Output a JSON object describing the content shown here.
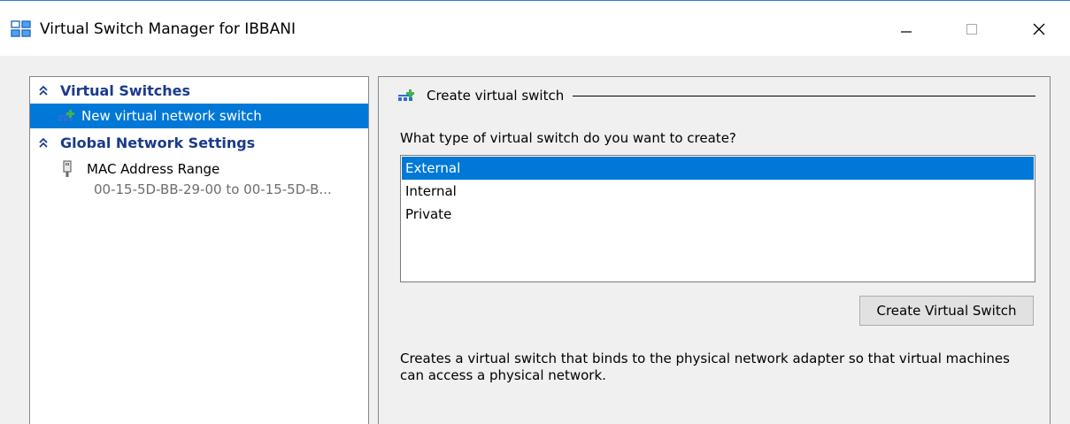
{
  "window": {
    "title": "Virtual Switch Manager for IBBANI",
    "accent_color": "#0078d7",
    "controls": {
      "minimize_icon": "minimize-icon",
      "maximize_icon": "maximize-icon",
      "close_icon": "close-icon"
    }
  },
  "sidebar": {
    "sections": [
      {
        "label": "Virtual Switches",
        "items": [
          {
            "label": "New virtual network switch",
            "icon": "add-network-switch-icon",
            "selected": true
          }
        ]
      },
      {
        "label": "Global Network Settings",
        "items": [
          {
            "label": "MAC Address Range",
            "subtext": "00-15-5D-BB-29-00 to 00-15-5D-B...",
            "icon": "network-adapter-icon",
            "selected": false
          }
        ]
      }
    ]
  },
  "main": {
    "group_title": "Create virtual switch",
    "question": "What type of virtual switch do you want to create?",
    "switch_types": [
      {
        "label": "External",
        "selected": true
      },
      {
        "label": "Internal",
        "selected": false
      },
      {
        "label": "Private",
        "selected": false
      }
    ],
    "create_button_label": "Create Virtual Switch",
    "description": "Creates a virtual switch that binds to the physical network adapter so that virtual machines can access a physical network."
  }
}
